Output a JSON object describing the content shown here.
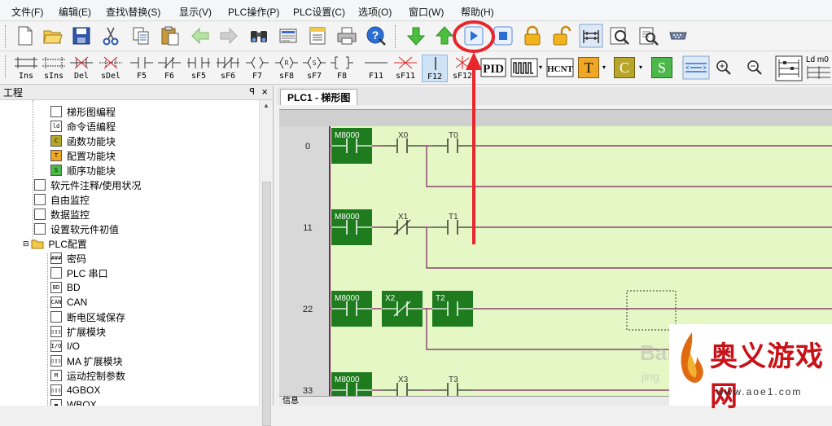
{
  "menu": [
    "文件(F)",
    "编辑(E)",
    "查找\\替换(S)",
    "显示(V)",
    "PLC操作(P)",
    "PLC设置(C)",
    "选项(O)",
    "窗口(W)",
    "帮助(H)"
  ],
  "toolbar2": {
    "buttons": [
      "Ins",
      "sIns",
      "Del",
      "sDel",
      "F5",
      "F6",
      "sF5",
      "sF6",
      "F7",
      "sF8",
      "sF7",
      "F8",
      "F11",
      "sF11",
      "F12",
      "sF12"
    ],
    "selected": "F12",
    "pid_label": "PID",
    "hcnt_label": "HCNT",
    "t_label": "T",
    "c_label": "C",
    "s_label": "S",
    "ld_label": "Ld m0"
  },
  "project_panel": {
    "title": "工程",
    "pin": "ꟼ",
    "close": "×",
    "items": [
      {
        "label": "梯形图编程",
        "icon": "ladder-icon"
      },
      {
        "label": "命令语编程",
        "icon": "ld-icon",
        "icon_text": "ld"
      },
      {
        "label": "函数功能块",
        "icon": "c-block-icon",
        "icon_text": "C"
      },
      {
        "label": "配置功能块",
        "icon": "t-block-icon",
        "icon_text": "T"
      },
      {
        "label": "顺序功能块",
        "icon": "s-block-icon",
        "icon_text": "S"
      },
      {
        "label": "软元件注释/使用状况",
        "icon": "list-icon"
      },
      {
        "label": "自由监控",
        "icon": "monitor-icon"
      },
      {
        "label": "数据监控",
        "icon": "data-monitor-icon"
      },
      {
        "label": "设置软元件初值",
        "icon": "init-icon"
      },
      {
        "label": "PLC配置",
        "icon": "folder-icon"
      },
      {
        "label": "密码",
        "icon": "password-icon",
        "icon_text": "###"
      },
      {
        "label": "PLC 串口",
        "icon": "serial-icon"
      },
      {
        "label": "BD",
        "icon": "bd-icon",
        "icon_text": "BD"
      },
      {
        "label": "CAN",
        "icon": "can-icon",
        "icon_text": "CAN"
      },
      {
        "label": "断电区域保存",
        "icon": "power-save-icon"
      },
      {
        "label": "扩展模块",
        "icon": "ext-module-icon",
        "icon_text": "▯▯▯"
      },
      {
        "label": "I/O",
        "icon": "io-icon",
        "icon_text": "I/O"
      },
      {
        "label": "MA 扩展模块",
        "icon": "ma-module-icon",
        "icon_text": "▯▯▯"
      },
      {
        "label": "运动控制参数",
        "icon": "motion-icon",
        "icon_text": "M"
      },
      {
        "label": "4GBOX",
        "icon": "4gbox-icon",
        "icon_text": "▯▯▯"
      },
      {
        "label": "WBOX",
        "icon": "wbox-icon",
        "icon_text": "▬"
      }
    ]
  },
  "editor": {
    "tab_label": "PLC1 - 梯形图",
    "rows": [
      {
        "num": "0",
        "contacts": [
          {
            "label": "M8000",
            "type": "NO",
            "active": true
          },
          {
            "label": "X0",
            "type": "NO",
            "active": false
          },
          {
            "label": "T0",
            "type": "NO",
            "active": false
          }
        ]
      },
      {
        "num": "11",
        "contacts": [
          {
            "label": "M8000",
            "type": "NO",
            "active": true
          },
          {
            "label": "X1",
            "type": "NC",
            "active": false
          },
          {
            "label": "T1",
            "type": "NO",
            "active": false
          }
        ]
      },
      {
        "num": "22",
        "contacts": [
          {
            "label": "M8000",
            "type": "NO",
            "active": true
          },
          {
            "label": "X2",
            "type": "NC",
            "active": true
          },
          {
            "label": "T2",
            "type": "NO",
            "active": true
          }
        ]
      },
      {
        "num": "33",
        "contacts": [
          {
            "label": "M8000",
            "type": "NO",
            "active": true
          },
          {
            "label": "X3",
            "type": "NO",
            "active": false
          },
          {
            "label": "T3",
            "type": "NO",
            "active": false
          }
        ]
      }
    ],
    "status_label": "信息"
  },
  "watermarks": {
    "site_name": "奥义游戏网",
    "site_url": "www.aoe1.com",
    "baidu_text": "Bai",
    "baidu_sub": "jing"
  },
  "colors": {
    "active_contact": "#1e7c1e",
    "ladder_bg": "#e4f7c4",
    "rail": "#7a2060",
    "highlight_red": "#e8262b",
    "play_blue": "#2a6fd1"
  }
}
